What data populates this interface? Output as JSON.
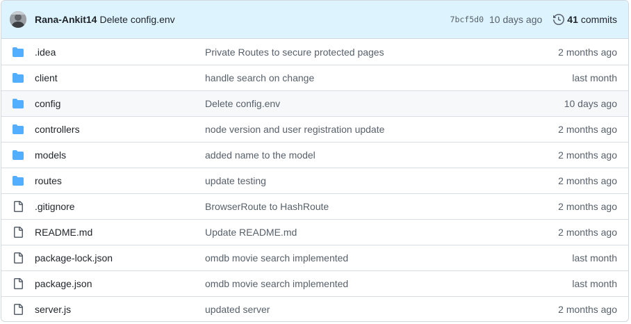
{
  "header": {
    "author": "Rana-Ankit14",
    "message": "Delete config.env",
    "sha": "7bcf5d0",
    "time": "10 days ago",
    "commits_count": "41",
    "commits_label": "commits"
  },
  "colors": {
    "folder": "#54aeff",
    "file": "#57606a",
    "header_bg": "#ddf4ff"
  },
  "files": [
    {
      "type": "folder",
      "name": ".idea",
      "message": "Private Routes to secure protected pages",
      "age": "2 months ago"
    },
    {
      "type": "folder",
      "name": "client",
      "message": "handle search on change",
      "age": "last month"
    },
    {
      "type": "folder",
      "name": "config",
      "message": "Delete config.env",
      "age": "10 days ago"
    },
    {
      "type": "folder",
      "name": "controllers",
      "message": "node version and user registration update",
      "age": "2 months ago"
    },
    {
      "type": "folder",
      "name": "models",
      "message": "added name to the model",
      "age": "2 months ago"
    },
    {
      "type": "folder",
      "name": "routes",
      "message": "update testing",
      "age": "2 months ago"
    },
    {
      "type": "file",
      "name": ".gitignore",
      "message": "BrowserRoute to HashRoute",
      "age": "2 months ago"
    },
    {
      "type": "file",
      "name": "README.md",
      "message": "Update README.md",
      "age": "2 months ago"
    },
    {
      "type": "file",
      "name": "package-lock.json",
      "message": "omdb movie search implemented",
      "age": "last month"
    },
    {
      "type": "file",
      "name": "package.json",
      "message": "omdb movie search implemented",
      "age": "last month"
    },
    {
      "type": "file",
      "name": "server.js",
      "message": "updated server",
      "age": "2 months ago"
    }
  ]
}
